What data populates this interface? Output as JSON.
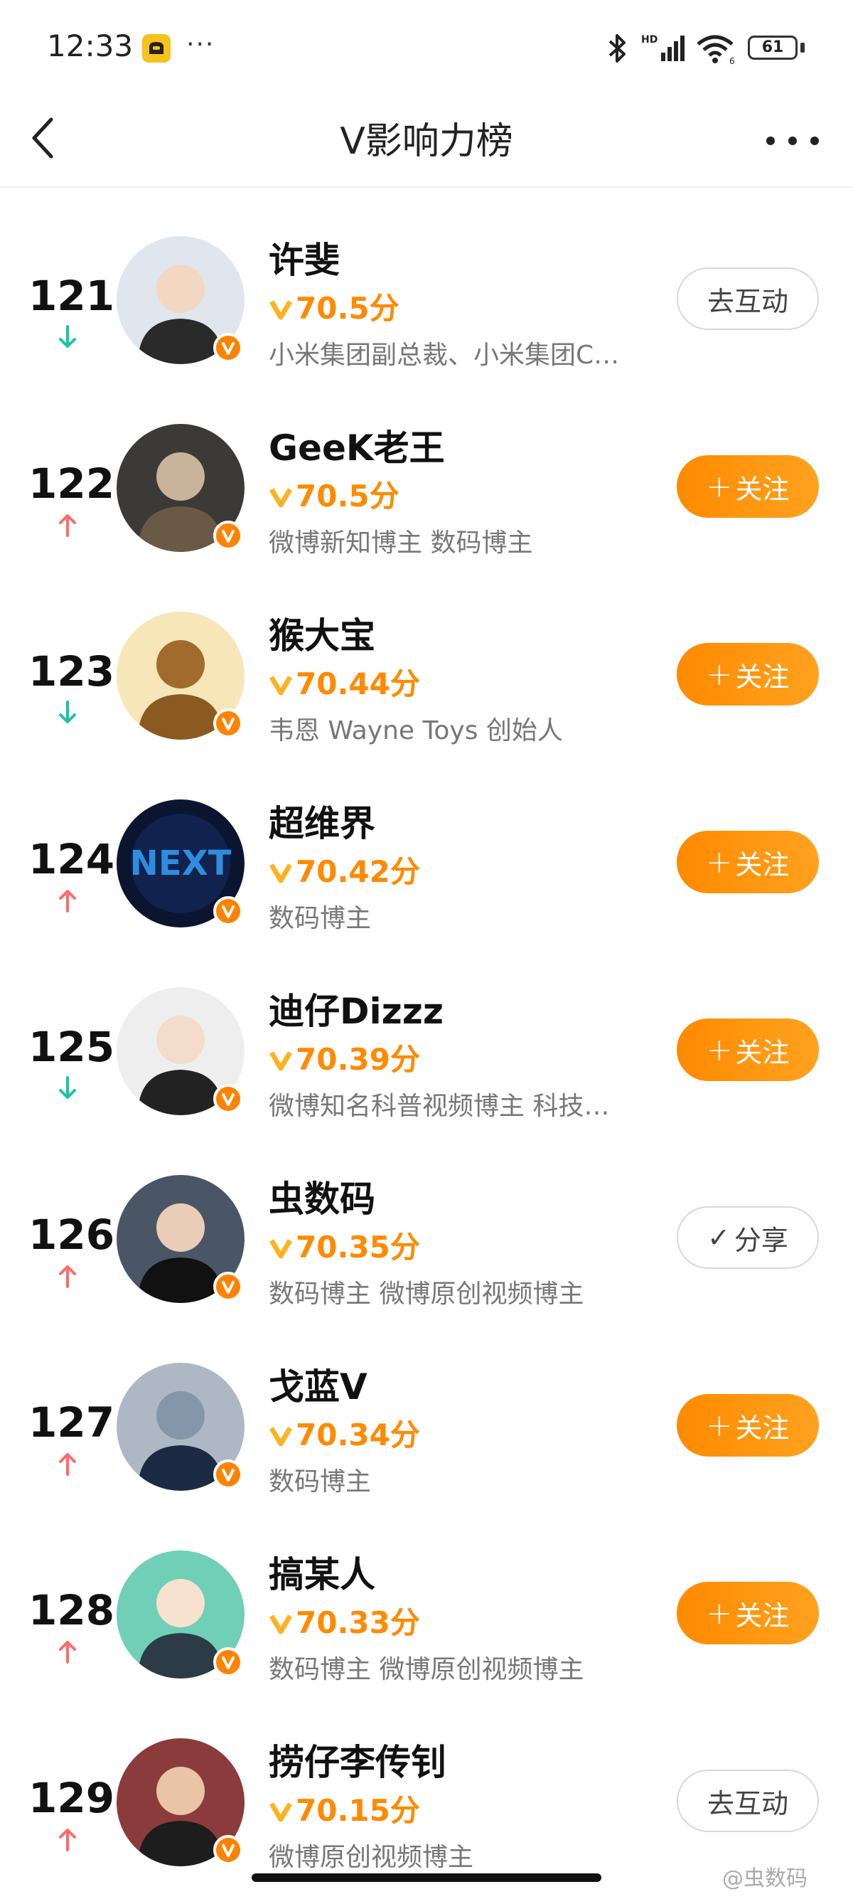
{
  "status_bar": {
    "time": "12:33",
    "battery": "61",
    "more": "···"
  },
  "nav": {
    "title": "V影响力榜"
  },
  "colors": {
    "accent": "#ff8a00",
    "up": "#ff5a5a",
    "down": "#1cc2a8"
  },
  "rows": [
    {
      "rank": "121",
      "trend": "down",
      "name": "许斐",
      "score": "70.5分",
      "desc": "小米集团副总裁、小米集团C…",
      "button": "去互动",
      "button_style": "outline"
    },
    {
      "rank": "122",
      "trend": "up",
      "name": "GeeK老王",
      "score": "70.5分",
      "desc": "微博新知博主 数码博主",
      "button": "关注",
      "button_style": "follow"
    },
    {
      "rank": "123",
      "trend": "down",
      "name": "猴大宝",
      "score": "70.44分",
      "desc": "韦恩 Wayne Toys 创始人",
      "button": "关注",
      "button_style": "follow"
    },
    {
      "rank": "124",
      "trend": "up",
      "name": "超维界",
      "score": "70.42分",
      "desc": "数码博主",
      "button": "关注",
      "button_style": "follow"
    },
    {
      "rank": "125",
      "trend": "down",
      "name": "迪仔Dizzz",
      "score": "70.39分",
      "desc": "微博知名科普视频博主 科技…",
      "button": "关注",
      "button_style": "follow"
    },
    {
      "rank": "126",
      "trend": "up",
      "name": "虫数码",
      "score": "70.35分",
      "desc": "数码博主 微博原创视频博主",
      "button": "分享",
      "button_style": "check"
    },
    {
      "rank": "127",
      "trend": "up",
      "name": "戈蓝V",
      "score": "70.34分",
      "desc": "数码博主",
      "button": "关注",
      "button_style": "follow"
    },
    {
      "rank": "128",
      "trend": "up",
      "name": "搞某人",
      "score": "70.33分",
      "desc": "数码博主 微博原创视频博主",
      "button": "关注",
      "button_style": "follow"
    },
    {
      "rank": "129",
      "trend": "up",
      "name": "捞仔李传钊",
      "score": "70.15分",
      "desc": "微博原创视频博主",
      "button": "去互动",
      "button_style": "outline"
    }
  ],
  "watermark": "@虫数码"
}
